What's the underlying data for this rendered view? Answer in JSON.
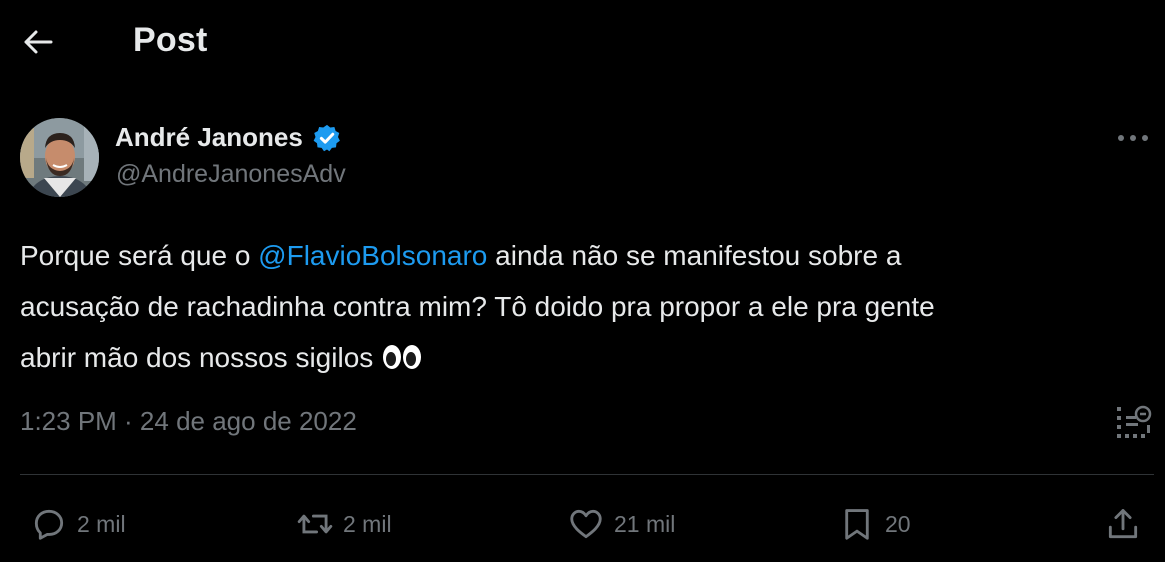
{
  "header": {
    "back_icon": "arrow-left-icon",
    "title": "Post"
  },
  "tweet": {
    "author_name": "André Janones",
    "verified_icon": "verified-badge-icon",
    "verified_color": "#1d9bf0",
    "handle": "@AndreJanonesAdv",
    "more_icon": "more-horizontal-icon",
    "text_line1_before": "Porque será que o ",
    "mention": "@FlavioBolsonaro",
    "text_line1_after": " ainda não se manifestou sobre a",
    "text_line2": "acusação de rachadinha contra mim? Tô doido pra propor a ele pra gente",
    "text_line3": "abrir mão dos nossos sigilos",
    "emoji": "eyes-emoji",
    "timestamp": "1:23 PM · 24 de ago de 2022",
    "analytics_icon": "analytics-icon"
  },
  "actions": {
    "reply_count": "2 mil",
    "retweet_count": "2 mil",
    "like_count": "21 mil",
    "bookmark_count": "20",
    "share_icon": "share-icon"
  },
  "colors": {
    "background": "#000000",
    "text": "#e7e9ea",
    "muted": "#71767b",
    "accent": "#1d9bf0",
    "divider": "#2f3336"
  }
}
